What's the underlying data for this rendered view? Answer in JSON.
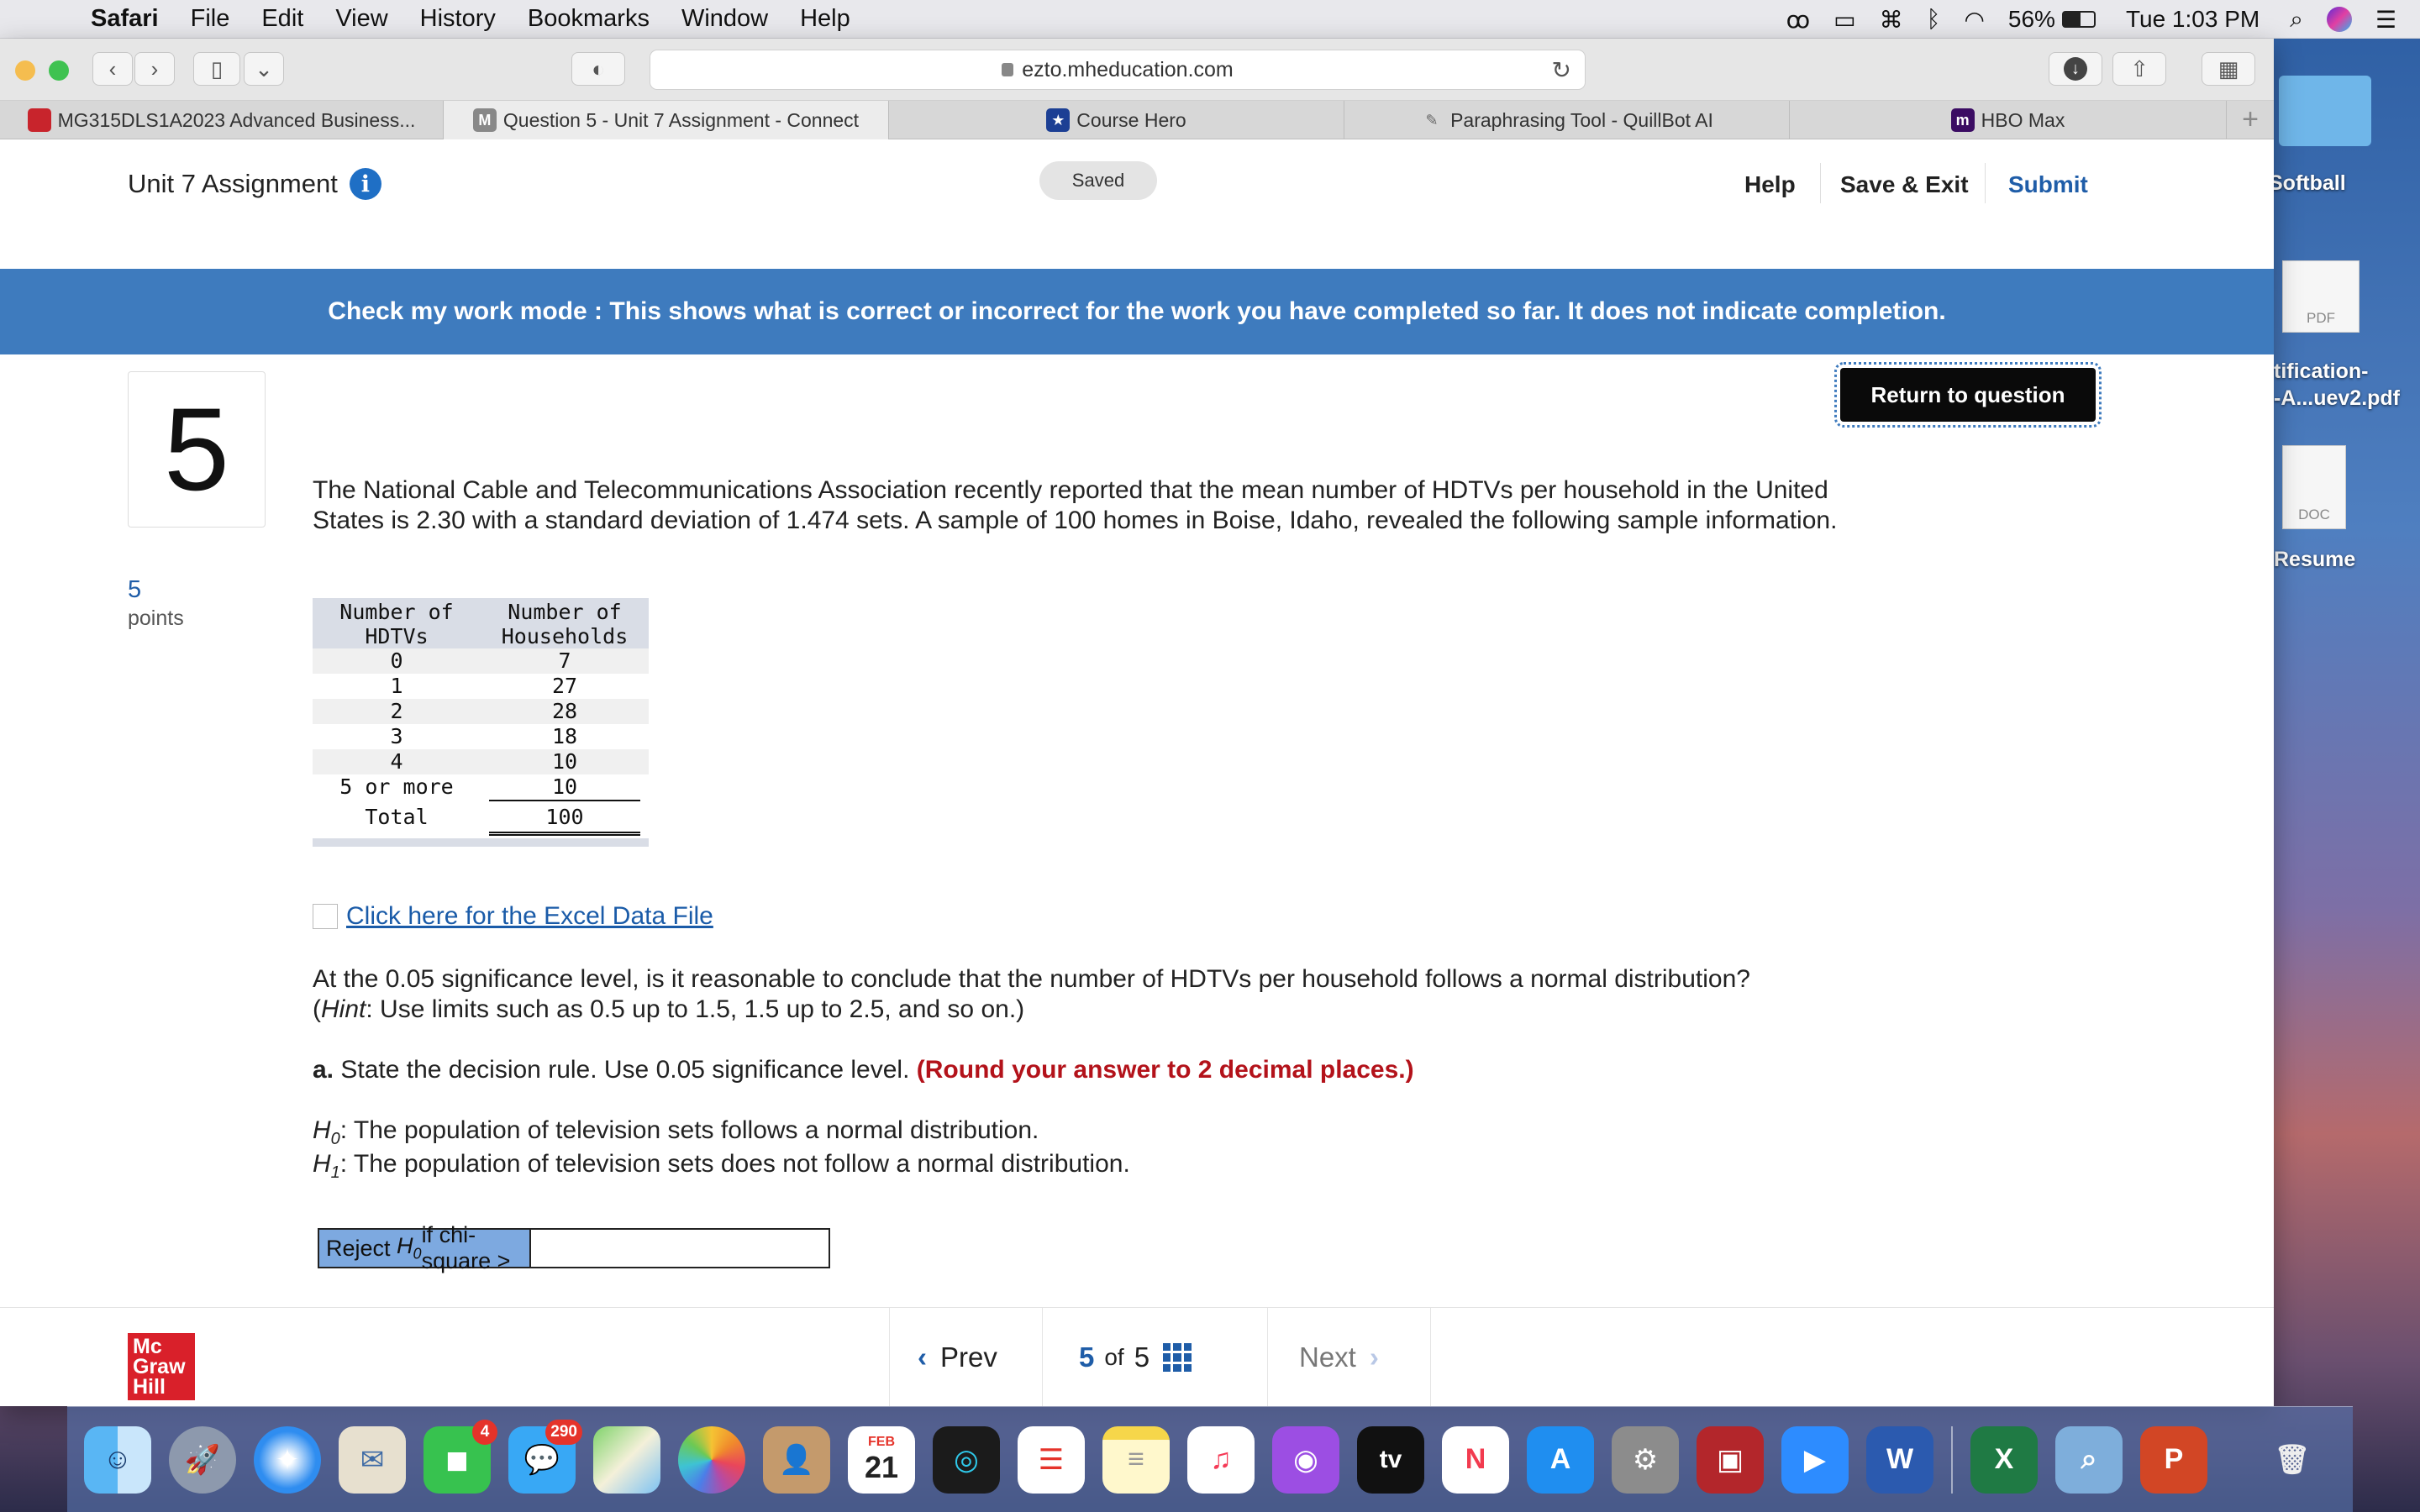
{
  "menubar": {
    "app": "Safari",
    "items": [
      "File",
      "Edit",
      "View",
      "History",
      "Bookmarks",
      "Window",
      "Help"
    ],
    "battery": "56%",
    "clock": "Tue 1:03 PM"
  },
  "browser": {
    "url": "ezto.mheducation.com",
    "tabs": [
      {
        "label": "MG315DLS1A2023 Advanced Business..."
      },
      {
        "label": "Question 5 - Unit 7 Assignment - Connect"
      },
      {
        "label": "Course Hero"
      },
      {
        "label": "Paraphrasing Tool - QuillBot AI"
      },
      {
        "label": "HBO Max"
      }
    ]
  },
  "header": {
    "title": "Unit 7 Assignment",
    "saved": "Saved",
    "help": "Help",
    "save_exit": "Save & Exit",
    "submit": "Submit"
  },
  "banner": "Check my work mode : This shows what is correct or incorrect for the work you have completed so far. It does not indicate completion.",
  "question": {
    "return_button": "Return to question",
    "number": "5",
    "points_value": "5",
    "points_label": "points",
    "intro": "The National Cable and Telecommunications Association recently reported that the mean number of HDTVs per household in the United States is 2.30 with a standard deviation of 1.474 sets. A sample of 100 homes in Boise, Idaho, revealed the following sample information.",
    "table": {
      "col1": "Number of HDTVs",
      "col2": "Number of Households",
      "rows": [
        {
          "hdtvs": "0",
          "households": "7"
        },
        {
          "hdtvs": "1",
          "households": "27"
        },
        {
          "hdtvs": "2",
          "households": "28"
        },
        {
          "hdtvs": "3",
          "households": "18"
        },
        {
          "hdtvs": "4",
          "households": "10"
        },
        {
          "hdtvs": "5 or more",
          "households": "10"
        }
      ],
      "total_label": "Total",
      "total_value": "100"
    },
    "excel_link": "Click here for the Excel Data File",
    "prompt_main": "At the 0.05 significance level, is it reasonable to conclude that the number of HDTVs per household follows a normal distribution?",
    "hint_label": "Hint",
    "hint_text": ": Use limits such as 0.5 up to 1.5, 1.5 up to 2.5, and so on.)",
    "part_a_label": "a.",
    "part_a_text": "State the decision rule. Use 0.05 significance level.",
    "part_a_round": "(Round your answer to 2 decimal places.)",
    "h0_text": ": The population of television sets follows a normal distribution.",
    "h1_text": ": The population of television sets does not follow a normal distribution.",
    "answer_label_pre": "Reject ",
    "answer_label_post": " if chi-square >",
    "answer_value": ""
  },
  "footer": {
    "prev": "Prev",
    "current": "5",
    "of": "of",
    "total": "5",
    "next": "Next",
    "logo_lines": [
      "Mc",
      "Graw",
      "Hill"
    ]
  },
  "desktop": {
    "icons": [
      "Softball",
      "tification-",
      "-A...uev2.pdf",
      "Resume"
    ],
    "pdf_tag": "PDF",
    "doc_tag": "DOC"
  },
  "dock": {
    "facetime_badge": "4",
    "messages_badge": "290",
    "calendar_month": "FEB",
    "calendar_day": "21",
    "tv_label": "tv"
  }
}
